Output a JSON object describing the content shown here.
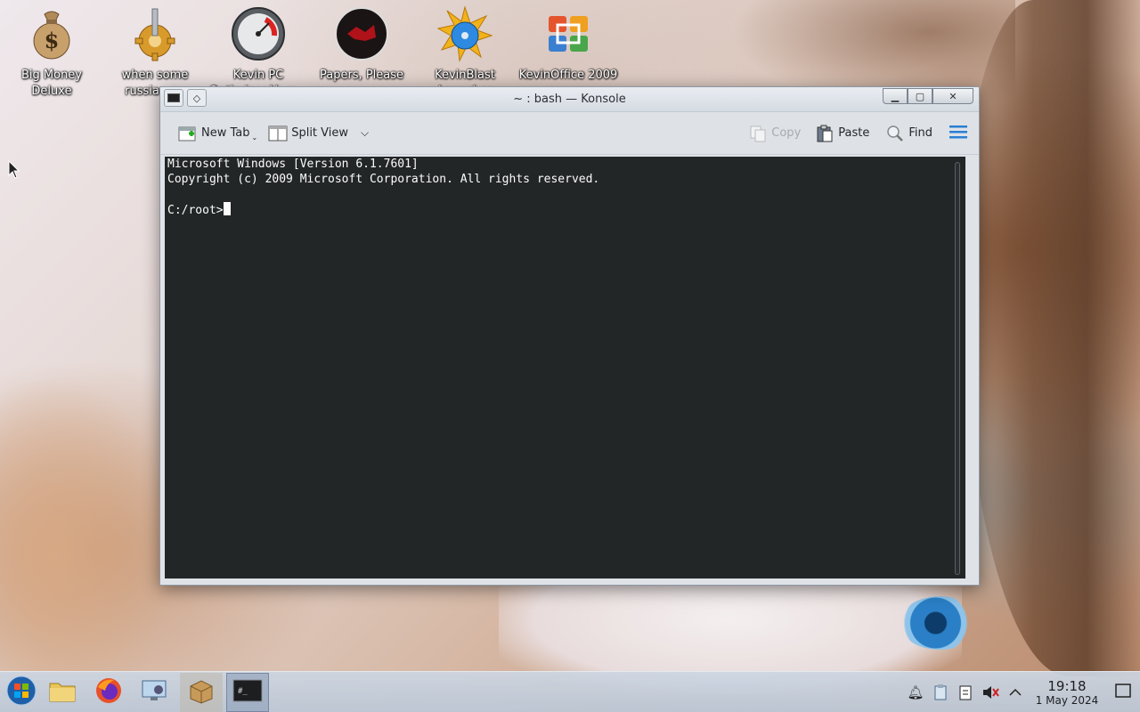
{
  "desktop": {
    "icons": [
      {
        "label": "Big Money\nDeluxe",
        "icon": "money-bag-icon"
      },
      {
        "label": "when some\nrussian r...",
        "icon": "gear-icon"
      },
      {
        "label": "Kevin PC\nOptimizer Hom...",
        "icon": "speedometer-icon"
      },
      {
        "label": "Papers, Please",
        "icon": "papers-please-icon"
      },
      {
        "label": "KevinBlast\nLauncher",
        "icon": "disc-burst-icon"
      },
      {
        "label": "KevinOffice 2009",
        "icon": "office-logo-icon"
      }
    ]
  },
  "window": {
    "title": "~ : bash — Konsole",
    "toolbar": {
      "new_tab": "New Tab",
      "split_view": "Split View",
      "copy": "Copy",
      "paste": "Paste",
      "find": "Find"
    },
    "terminal": {
      "line1": "Microsoft Windows [Version 6.1.7601]",
      "line2": "Copyright (c) 2009 Microsoft Corporation. All rights reserved.",
      "prompt": "C:/root>"
    }
  },
  "taskbar": {
    "items": [
      "start-menu",
      "file-manager",
      "firefox",
      "system-settings",
      "package-manager",
      "konsole"
    ],
    "clock": {
      "time": "19:18",
      "date": "1 May 2024"
    }
  },
  "colors": {
    "terminal_bg": "#232627",
    "terminal_fg": "#fcfcfc",
    "accent": "#2b7fd4"
  }
}
